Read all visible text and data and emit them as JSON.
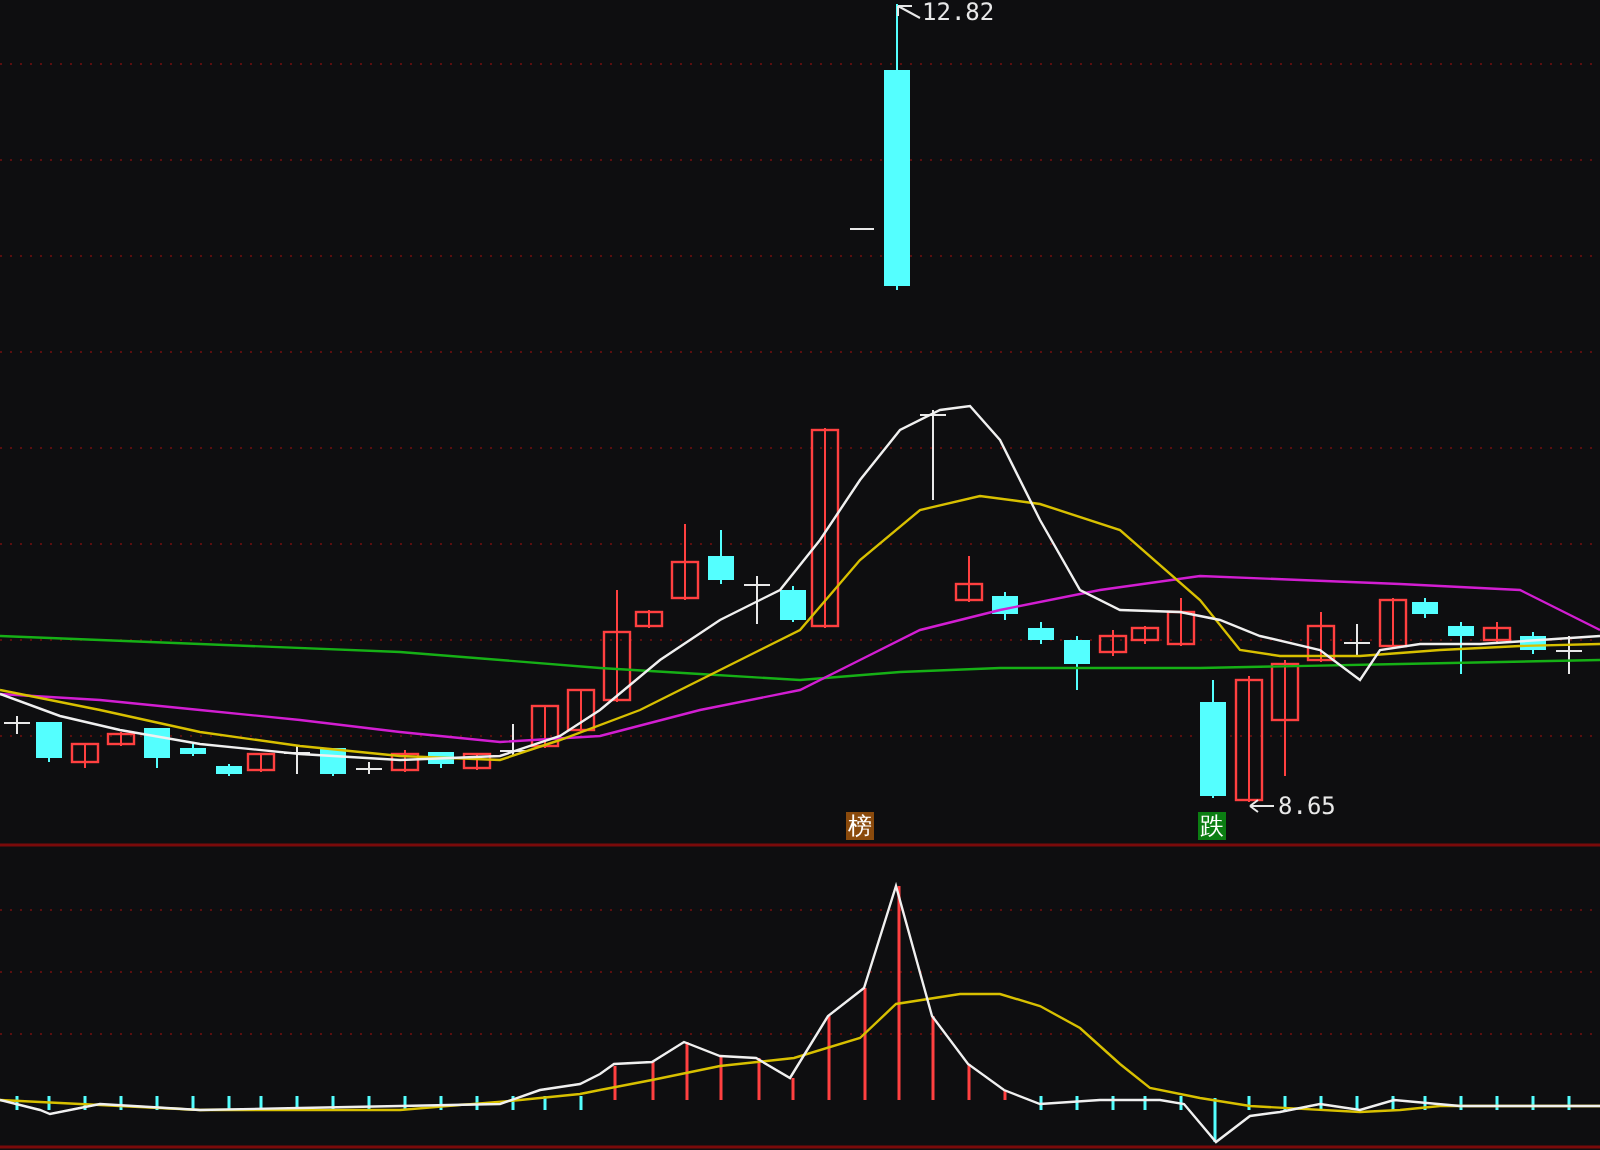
{
  "price_labels": [
    {
      "kind": "high",
      "text": "12.82"
    },
    {
      "kind": "low",
      "text": "8.65"
    }
  ],
  "badges": [
    {
      "text": "榜",
      "color": "#8a4a0c"
    },
    {
      "text": "跌",
      "color": "#0b7d12"
    }
  ]
}
